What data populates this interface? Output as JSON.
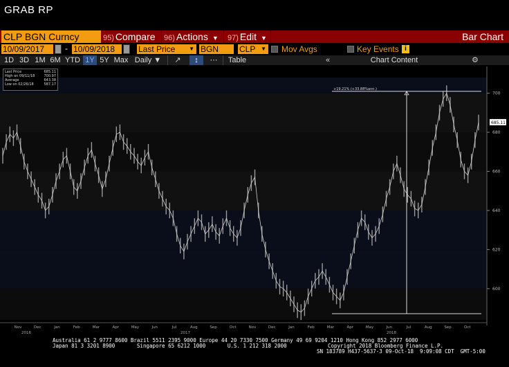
{
  "window": {
    "title": "GRAB RP"
  },
  "toolbar": {
    "ticker": "CLP BGN Curncy",
    "compare": {
      "num": "95)",
      "label": "Compare"
    },
    "actions": {
      "num": "96)",
      "label": "Actions"
    },
    "edit": {
      "num": "97)",
      "label": "Edit"
    },
    "chart_type": "Bar Chart"
  },
  "fields": {
    "start_date": "10/09/2017",
    "end_date": "10/09/2018",
    "dash": "-",
    "field": "Last Price",
    "source": "BGN",
    "currency": "CLP",
    "mov_avgs": "Mov Avgs",
    "key_events": "Key Events",
    "info": "i"
  },
  "ranges": {
    "items": [
      "1D",
      "3D",
      "1M",
      "6M",
      "YTD",
      "1Y",
      "5Y",
      "Max"
    ],
    "active": "1Y",
    "frequency": "Daily ▼",
    "table": "Table",
    "collapse": "«",
    "chart_content": "Chart Content",
    "gear": "⚙"
  },
  "legend": {
    "rows": [
      {
        "label": "Last Price",
        "value": "685.11"
      },
      {
        "label": "High on 09/11/18",
        "value": "700.97"
      },
      {
        "label": "Average",
        "value": "643.38"
      },
      {
        "label": "Low on 02/26/18",
        "value": "587.17"
      }
    ]
  },
  "annotation": {
    "text": "+19.21% (+33.88%ann.)"
  },
  "colors": {
    "accent_orange": "#f39c12",
    "command_red": "#8b0000",
    "active_blue": "#2c4a7a",
    "price_line": "#cfcfcf"
  },
  "chart_data": {
    "type": "line",
    "title": "",
    "xlabel": "",
    "ylabel": "",
    "ylim": [
      584,
      708
    ],
    "y_ticks": [
      600,
      620,
      640,
      660,
      680,
      700
    ],
    "current_price_label": "685.11",
    "x_months": [
      "Nov",
      "Dec",
      "Jan",
      "Feb",
      "Mar",
      "Apr",
      "May",
      "Jun",
      "Jul",
      "Aug",
      "Sep",
      "Oct",
      "Nov",
      "Dec",
      "Jan",
      "Feb",
      "Mar",
      "Apr",
      "May",
      "Jun",
      "Jul",
      "Aug",
      "Sep",
      "Oct"
    ],
    "x_years": [
      "2016",
      "2017",
      "2018"
    ],
    "series": [
      {
        "name": "Last Price",
        "values": [
          668,
          675,
          679,
          677,
          680,
          673,
          665,
          660,
          656,
          652,
          648,
          645,
          640,
          642,
          648,
          655,
          660,
          666,
          668,
          660,
          652,
          650,
          655,
          662,
          668,
          671,
          664,
          658,
          651,
          656,
          664,
          672,
          679,
          680,
          675,
          673,
          670,
          668,
          665,
          663,
          667,
          670,
          662,
          656,
          650,
          646,
          642,
          640,
          636,
          628,
          622,
          619,
          624,
          628,
          632,
          636,
          634,
          628,
          630,
          633,
          629,
          627,
          632,
          636,
          631,
          628,
          626,
          631,
          640,
          648,
          654,
          657,
          640,
          628,
          620,
          614,
          609,
          604,
          601,
          600,
          598,
          595,
          592,
          589,
          588,
          590,
          596,
          600,
          604,
          606,
          609,
          606,
          602,
          598,
          596,
          594,
          598,
          606,
          614,
          622,
          630,
          636,
          634,
          629,
          626,
          628,
          632,
          638,
          646,
          652,
          660,
          664,
          658,
          651,
          648,
          646,
          641,
          640,
          643,
          652,
          662,
          672,
          680,
          690,
          697,
          700,
          694,
          684,
          676,
          666,
          660,
          658,
          665,
          676,
          685
        ]
      }
    ],
    "annotation_range": {
      "low": 587.17,
      "high": 700.97
    }
  },
  "footer": {
    "line1": "Australia 61 2 9777 8600 Brazil 5511 2395 9000 Europe 44 20 7330 7500 Germany 49 69 9204 1210 Hong Kong 852 2977 6000",
    "line2_left": "Japan 81 3 3201 8900       Singapore 65 6212 1000       U.S. 1 212 318 2000",
    "line2_right": "Copyright 2018 Bloomberg Finance L.P.",
    "line3": "SN 183789 H437-5637-3 09-Oct-18  9:09:08 CDT  GMT-5:00"
  }
}
